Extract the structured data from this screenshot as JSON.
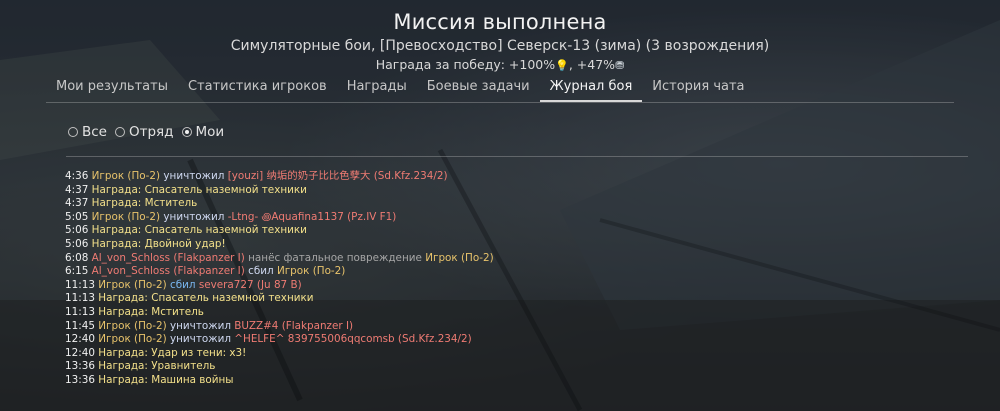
{
  "header": {
    "title": "Миссия выполнена",
    "subtitle": "Симуляторные бои, [Превосходство] Северск-13 (зима) (3 возрождения)",
    "reward_prefix": "Награда за победу: +100%",
    "reward_mid": ", +47%"
  },
  "tabs": [
    {
      "label": "Мои результаты"
    },
    {
      "label": "Статистика игроков"
    },
    {
      "label": "Награды"
    },
    {
      "label": "Боевые задачи"
    },
    {
      "label": "Журнал боя"
    },
    {
      "label": "История чата"
    }
  ],
  "filters": [
    {
      "label": "Все"
    },
    {
      "label": "Отряд"
    },
    {
      "label": "Мои"
    }
  ],
  "log": [
    {
      "time": "4:36",
      "a": "Игрок (По-2)",
      "verb": "уничтожил",
      "b": "[youzi] 纳垢的奶子比比色孽大 (Sd.Kfz.234/2)"
    },
    {
      "time": "4:37",
      "award": "Награда: Спасатель наземной техники"
    },
    {
      "time": "4:37",
      "award": "Награда: Мститель"
    },
    {
      "time": "5:05",
      "a": "Игрок (По-2)",
      "verb": "уничтожил",
      "b": "-Ltng- ꩜Aquafina1137 (Pz.IV F1)"
    },
    {
      "time": "5:06",
      "award": "Награда: Спасатель наземной техники"
    },
    {
      "time": "5:06",
      "award": "Награда: Двойной удар!"
    },
    {
      "time": "6:08",
      "a": "Al_von_Schloss (Flakpanzer I)",
      "verb": "нанёс фатальное повреждение",
      "b": "Игрок (По-2)"
    },
    {
      "time": "6:15",
      "a": "Al_von_Schloss (Flakpanzer I)",
      "verb": "сбил",
      "b": "Игрок (По-2)"
    },
    {
      "time": "11:13",
      "a": "Игрок (По-2)",
      "verb": "сбил",
      "b": "severa727 (Ju 87 B)"
    },
    {
      "time": "11:13",
      "award": "Награда: Спасатель наземной техники"
    },
    {
      "time": "11:13",
      "award": "Награда: Мститель"
    },
    {
      "time": "11:45",
      "a": "Игрок (По-2)",
      "verb": "уничтожил",
      "b": "BUZZ#4 (Flakpanzer I)"
    },
    {
      "time": "12:40",
      "a": "Игрок (По-2)",
      "verb": "уничтожил",
      "b": "^HELFE^ 839755006qqcomsb (Sd.Kfz.234/2)"
    },
    {
      "time": "12:40",
      "award": "Награда: Удар из тени: x3!"
    },
    {
      "time": "13:36",
      "award": "Награда: Уравнитель"
    },
    {
      "time": "13:36",
      "award": "Награда: Машина войны"
    }
  ],
  "colors": {
    "player": "#e8c36b",
    "enemy": "#ef7b73",
    "award": "#f3e08a",
    "active_tab": "#d8d8d8"
  }
}
